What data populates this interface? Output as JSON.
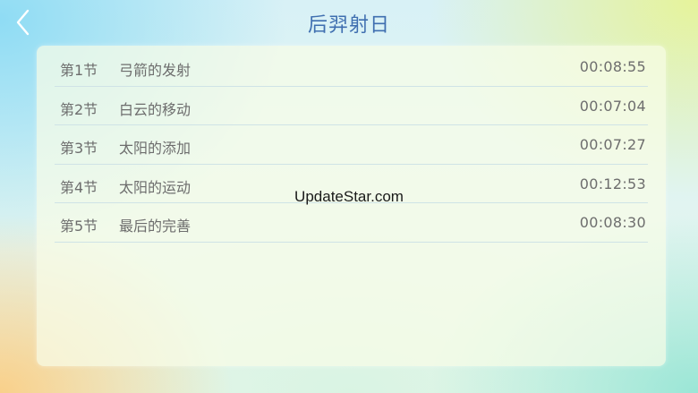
{
  "header": {
    "title": "后羿射日"
  },
  "sections": [
    {
      "label": "第1节",
      "name": "弓箭的发射",
      "duration": "00:08:55"
    },
    {
      "label": "第2节",
      "name": "白云的移动",
      "duration": "00:07:04"
    },
    {
      "label": "第3节",
      "name": "太阳的添加",
      "duration": "00:07:27"
    },
    {
      "label": "第4节",
      "name": "太阳的运动",
      "duration": "00:12:53"
    },
    {
      "label": "第5节",
      "name": "最后的完善",
      "duration": "00:08:30"
    }
  ],
  "watermark": "UpdateStar.com",
  "colors": {
    "title": "#3f6fb0",
    "row_text": "#6d6d6d",
    "divider": "#cfe3e6"
  }
}
